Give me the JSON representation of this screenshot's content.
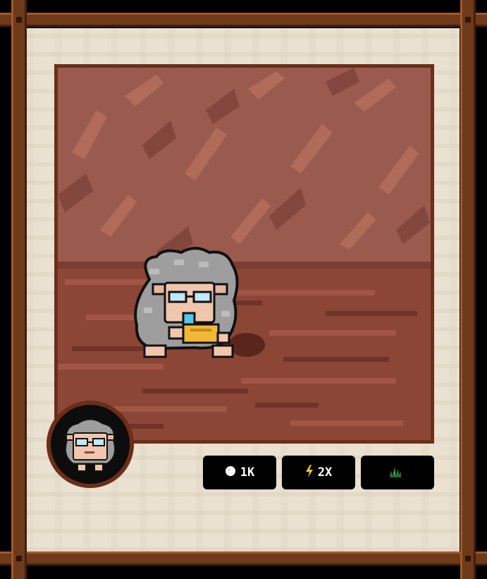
{
  "stats": {
    "coins": {
      "icon": "coin-icon",
      "value": "1K"
    },
    "boost": {
      "icon": "lightning-icon",
      "value": "2X"
    },
    "food": {
      "icon": "grass-icon",
      "value": ""
    }
  },
  "character": {
    "name": "sheep-with-glasses"
  },
  "colors": {
    "frame_wood": "#6e3a1a",
    "parchment": "#eae1d0",
    "scene_border": "#6b2e18",
    "wall": "#9a5a4e",
    "floor": "#8c4636",
    "wool": "#9e9e9e",
    "stat_bg": "#000000"
  }
}
